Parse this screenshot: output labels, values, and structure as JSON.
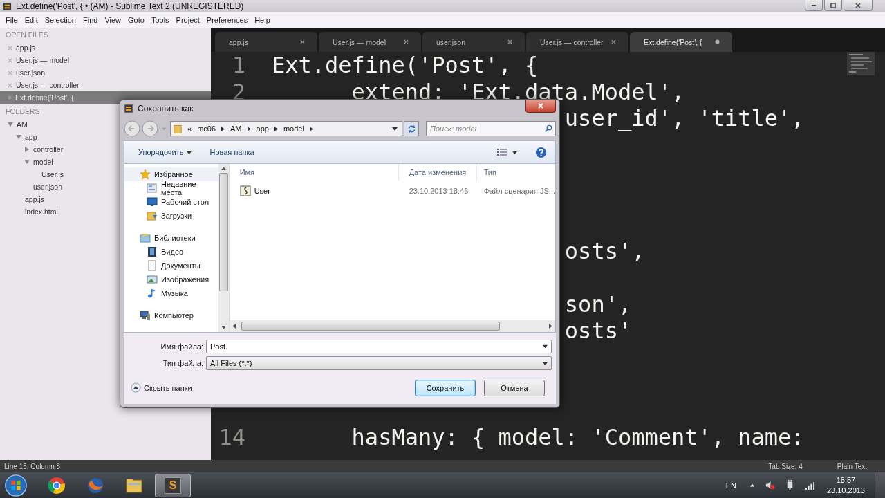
{
  "window": {
    "title": "Ext.define('Post', { • (AM) - Sublime Text 2 (UNREGISTERED)"
  },
  "menu": [
    "File",
    "Edit",
    "Selection",
    "Find",
    "View",
    "Goto",
    "Tools",
    "Project",
    "Preferences",
    "Help"
  ],
  "sidebar": {
    "open_files_heading": "OPEN FILES",
    "open_files": [
      {
        "label": "app.js",
        "selected": false,
        "modified": false
      },
      {
        "label": "User.js — model",
        "selected": false,
        "modified": false
      },
      {
        "label": "user.json",
        "selected": false,
        "modified": false
      },
      {
        "label": "User.js — controller",
        "selected": false,
        "modified": false
      },
      {
        "label": "Ext.define('Post', {",
        "selected": true,
        "modified": true
      }
    ],
    "folders_heading": "FOLDERS",
    "folders": [
      {
        "label": "AM",
        "kind": "folder",
        "expanded": true,
        "children": [
          {
            "label": "app",
            "kind": "folder",
            "expanded": true,
            "children": [
              {
                "label": "controller",
                "kind": "folder",
                "expanded": false
              },
              {
                "label": "model",
                "kind": "folder",
                "expanded": true,
                "children": [
                  {
                    "label": "User.js",
                    "kind": "file"
                  }
                ]
              },
              {
                "label": "user.json",
                "kind": "file"
              }
            ]
          },
          {
            "label": "app.js",
            "kind": "file"
          },
          {
            "label": "index.html",
            "kind": "file"
          }
        ]
      }
    ]
  },
  "tabs": [
    {
      "label": "app.js",
      "selected": false,
      "modified": false
    },
    {
      "label": "User.js — model",
      "selected": false,
      "modified": false
    },
    {
      "label": "user.json",
      "selected": false,
      "modified": false
    },
    {
      "label": "User.js — controller",
      "selected": false,
      "modified": false
    },
    {
      "label": "Ext.define('Post', {",
      "selected": true,
      "modified": true
    }
  ],
  "code_rows": [
    {
      "number": "1",
      "kind": "plain",
      "text": "Ext.define('Post', {"
    },
    {
      "number": "2",
      "kind": "indented",
      "text": "extend: 'Ext.data.Model',"
    },
    {
      "kind": "fragment",
      "text": "user_id', 'title',"
    },
    {},
    {},
    {},
    {},
    {
      "kind": "fragment",
      "text": "osts',"
    },
    {},
    {
      "kind": "fragment",
      "text": "son',"
    },
    {
      "kind": "fragment",
      "text": "osts'"
    },
    {},
    {},
    {},
    {
      "number": "14",
      "kind": "indented",
      "text": "hasMany: { model: 'Comment', name:"
    }
  ],
  "status_bar": {
    "position": "Line 15, Column 8",
    "tab_size": "Tab Size: 4",
    "syntax": "Plain Text"
  },
  "dialog": {
    "title": "Сохранить как",
    "overflow": "«",
    "path": [
      "mc06",
      "AM",
      "app",
      "model"
    ],
    "search_placeholder": "Поиск: model",
    "organize": "Упорядочить",
    "new_folder": "Новая папка",
    "nav": [
      {
        "label": "Избранное",
        "kind": "star",
        "children": [
          {
            "label": "Недавние места",
            "kind": "recent"
          },
          {
            "label": "Рабочий стол",
            "kind": "desktop"
          },
          {
            "label": "Загрузки",
            "kind": "downloads"
          }
        ]
      },
      {
        "label": "Библиотеки",
        "kind": "library",
        "children": [
          {
            "label": "Видео",
            "kind": "video"
          },
          {
            "label": "Документы",
            "kind": "documents"
          },
          {
            "label": "Изображения",
            "kind": "images"
          },
          {
            "label": "Музыка",
            "kind": "music"
          }
        ]
      },
      {
        "label": "Компьютер",
        "kind": "computer"
      }
    ],
    "columns": [
      "Имя",
      "Дата изменения",
      "Тип"
    ],
    "files": [
      {
        "name": "User",
        "date": "23.10.2013 18:46",
        "type": "Файл сценария JS..."
      }
    ],
    "file_name_label": "Имя файла:",
    "file_name": "Post.",
    "file_type_label": "Тип файла:",
    "file_type": "All Files (*.*)",
    "hide_folders": "Скрыть папки",
    "buttons": [
      {
        "label": "Сохранить",
        "default": true
      },
      {
        "label": "Отмена",
        "default": false
      }
    ]
  },
  "taskbar": {
    "apps": [
      {
        "kind": "chrome",
        "selected": false
      },
      {
        "kind": "firefox",
        "selected": false
      },
      {
        "kind": "explorer",
        "selected": false
      },
      {
        "kind": "sublime",
        "glyph": "S",
        "selected": true
      }
    ],
    "language": "EN",
    "time": "18:57",
    "date": "23.10.2013"
  }
}
